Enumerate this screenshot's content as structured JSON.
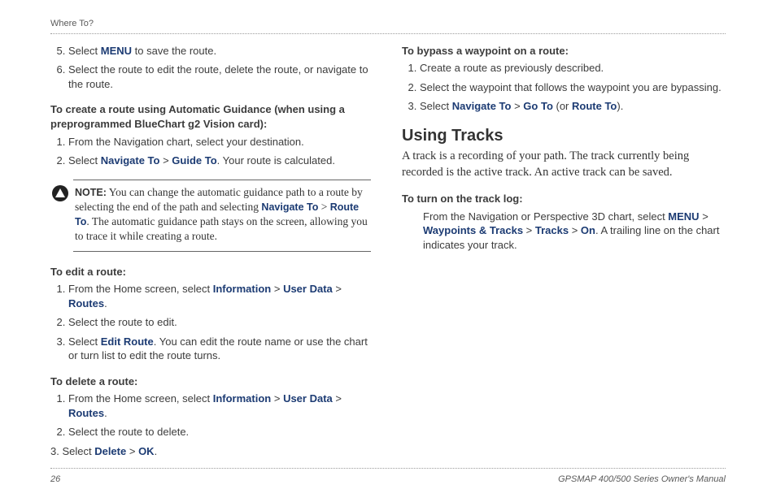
{
  "runningHead": "Where To?",
  "left": {
    "contList": [
      {
        "pre": "Select ",
        "ui1": "MENU",
        "post": " to save the route."
      },
      {
        "pre": "Select the route to edit the route, delete the route, or navigate to the route."
      }
    ],
    "autoGuide": {
      "head1": "To create a route using Automatic Guidance (when using a",
      "head2": "preprogrammed BlueChart g2 Vision card):",
      "items": [
        {
          "pre": "From the Navigation chart, select your destination."
        },
        {
          "pre": "Select ",
          "ui1": "Navigate To",
          "gt1": " > ",
          "ui2": "Guide To",
          "post": ". Your route is calculated."
        }
      ]
    },
    "note": {
      "lead": "NOTE:",
      "t1": " You can change the automatic guidance path to a route by selecting the end of the path and selecting ",
      "ui1": "Navigate To",
      "gt": " > ",
      "ui2": "Route To",
      "t2": ". The automatic guidance path stays on the screen, allowing you to trace it while creating a route."
    },
    "edit": {
      "head": "To edit a route:",
      "items": [
        {
          "pre": "From the Home screen, select ",
          "ui1": "Information",
          "gt1": " > ",
          "ui2": "User Data",
          "gt2": " > ",
          "ui3": "Routes",
          "post": "."
        },
        {
          "pre": "Select the route to edit."
        },
        {
          "pre": "Select ",
          "ui1": "Edit Route",
          "post": ". You can edit the route name or use the chart or turn list to edit the route turns."
        }
      ]
    },
    "delete": {
      "head": "To delete a route:",
      "items": [
        {
          "pre": "From the Home screen, select ",
          "ui1": "Information",
          "gt1": " > ",
          "ui2": "User Data",
          "gt2": " > ",
          "ui3": "Routes",
          "post": "."
        },
        {
          "pre": "Select the route to delete."
        }
      ],
      "lastLine": {
        "pre": "3. Select ",
        "ui1": "Delete",
        "gt1": " > ",
        "ui2": "OK",
        "post": "."
      }
    }
  },
  "right": {
    "bypass": {
      "head": "To bypass a waypoint on a route:",
      "items": [
        {
          "pre": "Create a route as previously described."
        },
        {
          "pre": "Select the waypoint that follows the waypoint you are bypassing."
        },
        {
          "pre": "Select ",
          "ui1": "Navigate To",
          "gt1": " > ",
          "ui2": "Go To",
          "mid": " (or ",
          "ui3": "Route To",
          "post": ")."
        }
      ]
    },
    "tracksHead": "Using Tracks",
    "tracksIntro": "A track is a recording of your path. The track currently being recorded is the active track. An active track can be saved.",
    "trackLog": {
      "head": "To turn on the track log:",
      "pre": "From the Navigation or Perspective 3D chart, select ",
      "ui1": "MENU",
      "gt1": " > ",
      "ui2": "Waypoints & Tracks",
      "gt2": " > ",
      "ui3": "Tracks",
      "gt3": " > ",
      "ui4": "On",
      "post": ". A trailing line on the chart indicates your track."
    }
  },
  "footer": {
    "page": "26",
    "title": "GPSMAP 400/500 Series Owner's Manual"
  }
}
